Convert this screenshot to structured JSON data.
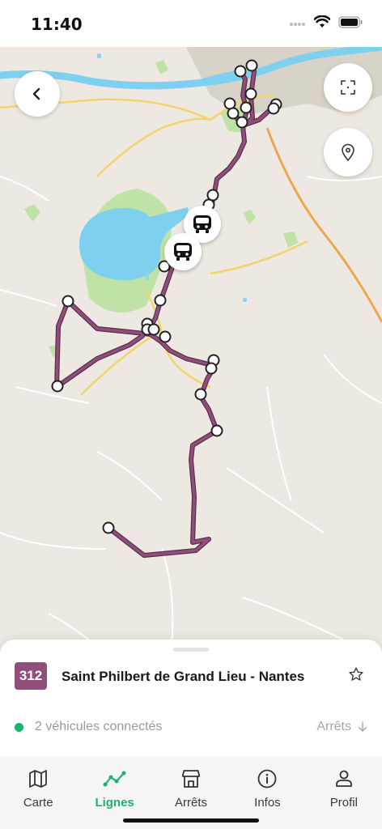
{
  "status_bar": {
    "time": "11:40"
  },
  "line": {
    "number": "312",
    "name": "Saint Philbert de Grand Lieu - Nantes",
    "color": "#8f4f7a"
  },
  "vehicles": {
    "text": "2 véhicules connectés",
    "status_color": "#1cb36e"
  },
  "stops_link": {
    "label": "Arrêts"
  },
  "map_controls": {
    "back": "chevron-left-icon",
    "scan": "scan-icon",
    "locate": "location-pin-icon"
  },
  "tabs": [
    {
      "label": "Carte",
      "icon": "map-icon",
      "active": false
    },
    {
      "label": "Lignes",
      "icon": "line-chart-icon",
      "active": true
    },
    {
      "label": "Arrêts",
      "icon": "store-icon",
      "active": false
    },
    {
      "label": "Infos",
      "icon": "info-icon",
      "active": false
    },
    {
      "label": "Profil",
      "icon": "person-icon",
      "active": false
    }
  ],
  "colors": {
    "accent": "#1cb36e",
    "route": "#8f4f7a",
    "map_background": "#ede9e2",
    "water": "#7fd0ee"
  }
}
